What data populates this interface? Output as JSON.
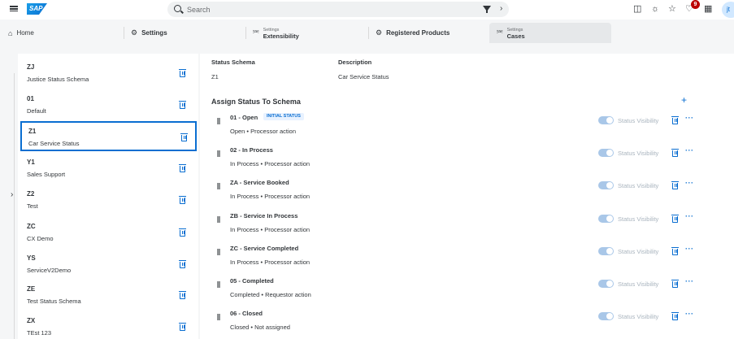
{
  "shell": {
    "logo_text": "SAP",
    "search_placeholder": "Search",
    "notification_count": "9",
    "avatar_initials": "jt"
  },
  "tabs": {
    "home": "Home",
    "settings": "Settings",
    "extensibility_sub": "Settings",
    "extensibility": "Extensibility",
    "registered_products": "Registered Products",
    "cases_sub": "Settings",
    "cases": "Cases"
  },
  "schemas": [
    {
      "code": "ZJ",
      "name": "Justice Status Schema"
    },
    {
      "code": "01",
      "name": "Default"
    },
    {
      "code": "Z1",
      "name": "Car Service Status"
    },
    {
      "code": "Y1",
      "name": "Sales Support"
    },
    {
      "code": "Z2",
      "name": "Test"
    },
    {
      "code": "ZC",
      "name": "CX Demo"
    },
    {
      "code": "YS",
      "name": "ServiceV2Demo"
    },
    {
      "code": "ZE",
      "name": "Test Status Schema"
    },
    {
      "code": "ZX",
      "name": "TEst 123"
    }
  ],
  "detail": {
    "status_schema_label": "Status Schema",
    "status_schema_value": "Z1",
    "description_label": "Description",
    "description_value": "Car Service Status",
    "section_title": "Assign Status To Schema",
    "initial_badge": "INITIAL STATUS",
    "visibility_label": "Status Visibility",
    "statuses": [
      {
        "title": "01 - Open",
        "sub": "Open • Processor action"
      },
      {
        "title": "02 - In Process",
        "sub": "In Process • Processor action"
      },
      {
        "title": "ZA - Service Booked",
        "sub": "In Process • Processor action"
      },
      {
        "title": "ZB - Service In Process",
        "sub": "In Process • Processor action"
      },
      {
        "title": "ZC - Service Completed",
        "sub": "In Process • Processor action"
      },
      {
        "title": "05 - Completed",
        "sub": "Completed • Requestor action"
      },
      {
        "title": "06 - Closed",
        "sub": "Closed • Not assigned"
      }
    ]
  }
}
